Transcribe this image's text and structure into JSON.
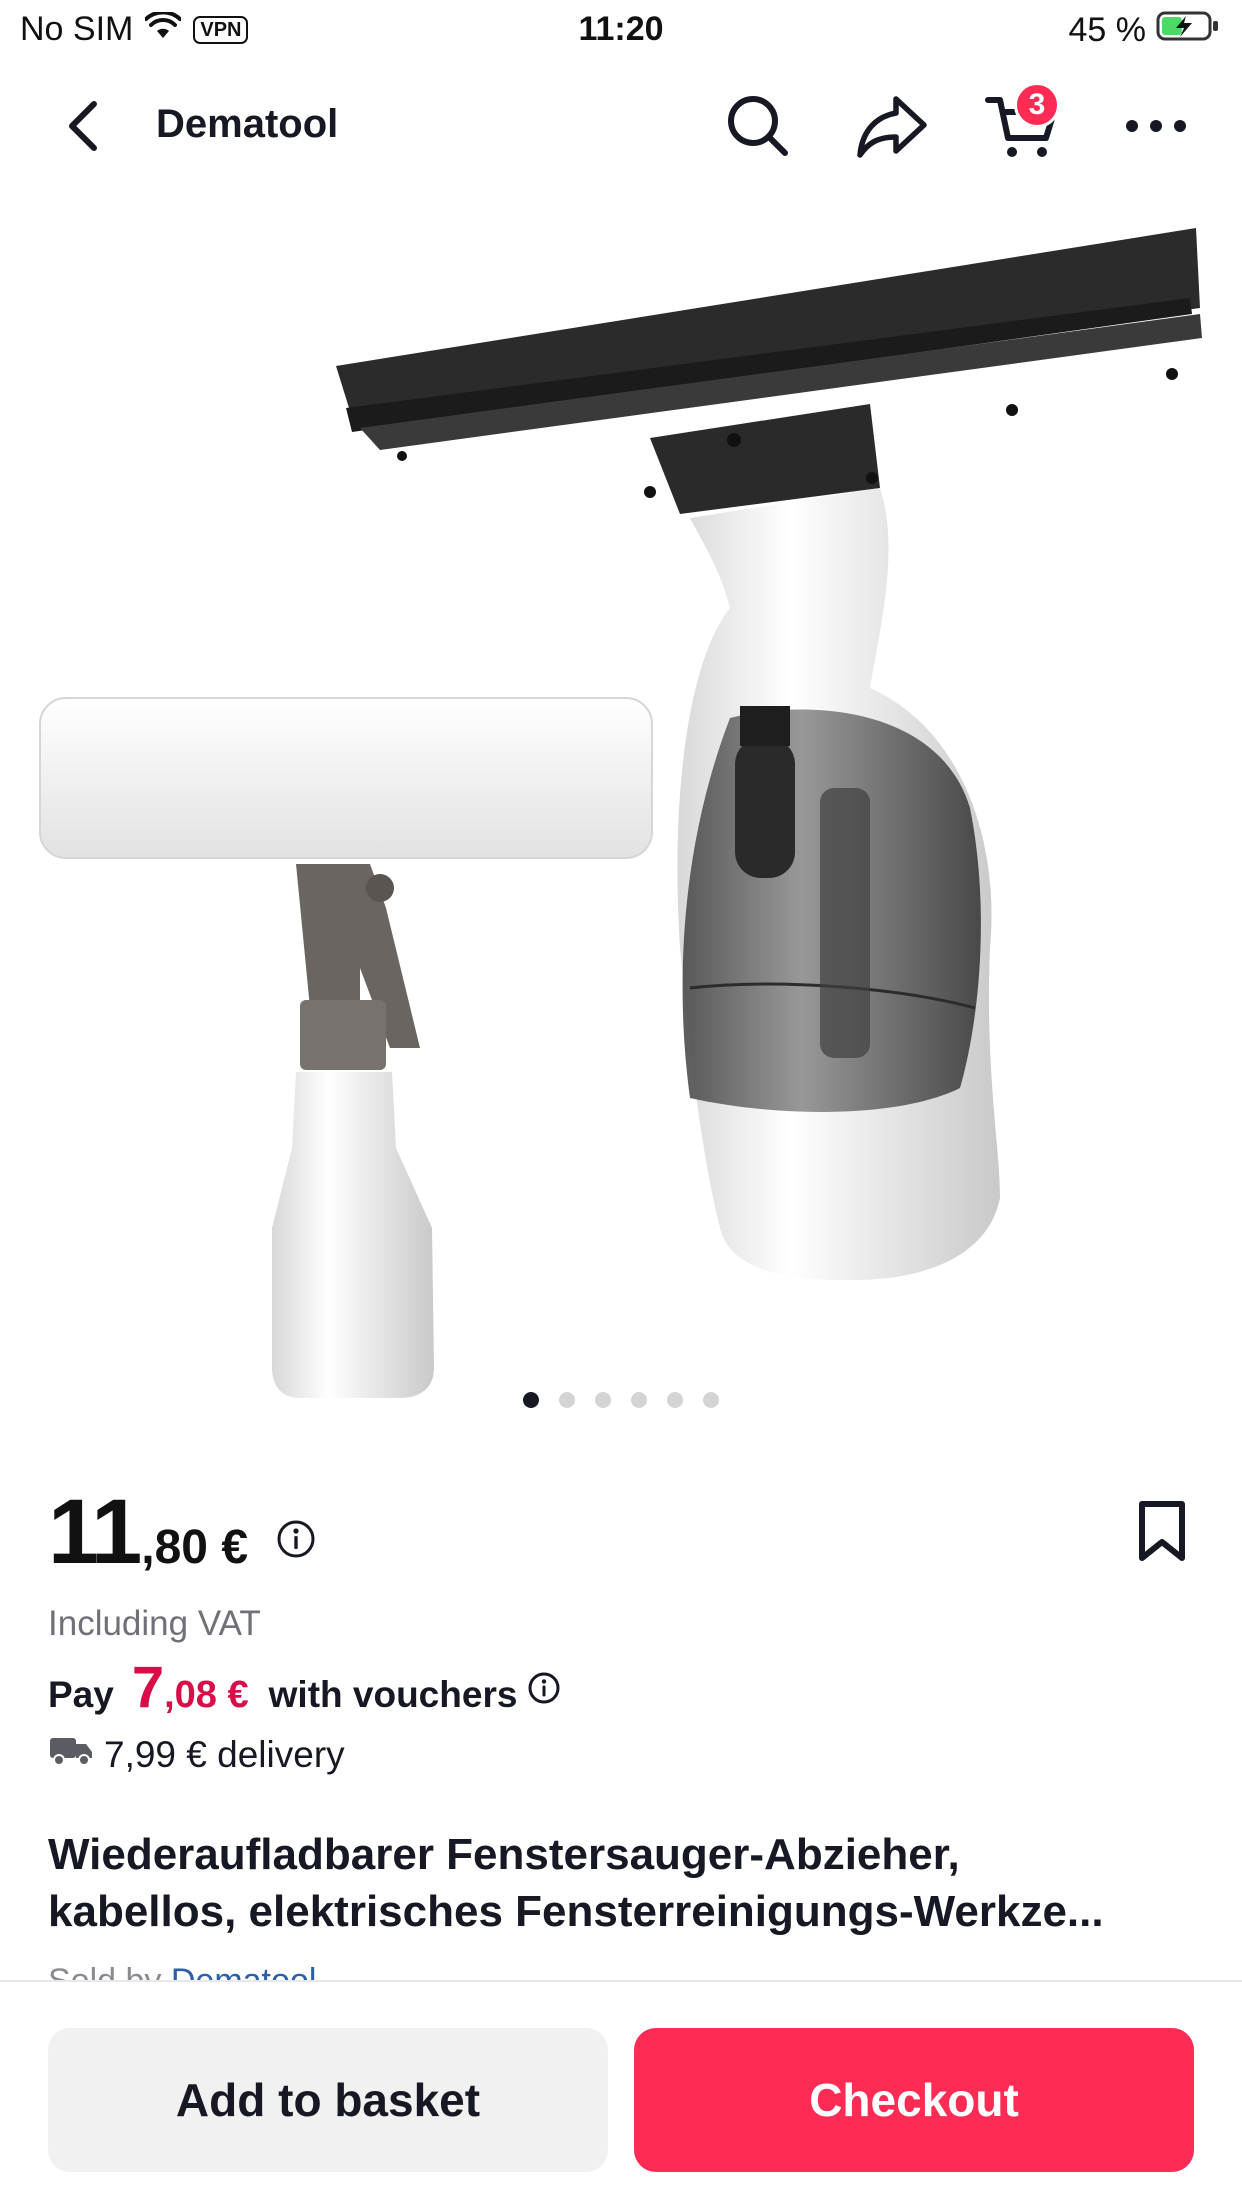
{
  "status_bar": {
    "carrier": "No SIM",
    "vpn": "VPN",
    "time": "11:20",
    "battery": "45 %",
    "battery_level": 0.45,
    "battery_color": "#4cd964"
  },
  "nav": {
    "store_name": "Dematool",
    "cart_count": "3",
    "icons": [
      "back-icon",
      "search-icon",
      "share-icon",
      "cart-icon",
      "more-icon"
    ]
  },
  "gallery": {
    "image_description_icon": "product-photo",
    "total_images": 6,
    "active_index": 0
  },
  "price": {
    "integer": "11",
    "decimal": ",80 €",
    "vat_note": "Including VAT"
  },
  "voucher": {
    "prefix": "Pay",
    "integer": "7",
    "decimal": ",08 €",
    "suffix": "with vouchers"
  },
  "delivery": {
    "text": "7,99 € delivery"
  },
  "product": {
    "title_line1": "Wiederaufladbarer Fenstersauger-Abzieher,",
    "title_line2": "kabellos, elektrisches Fensterreinigungs-Werkze...",
    "sold_by_prefix": "Sold by",
    "seller": "Dematool"
  },
  "actions": {
    "add_to_basket": "Add to basket",
    "checkout": "Checkout"
  },
  "colors": {
    "accent": "#fe2c55",
    "voucher_price": "#d70e47",
    "seller_link": "#2b5fab"
  }
}
